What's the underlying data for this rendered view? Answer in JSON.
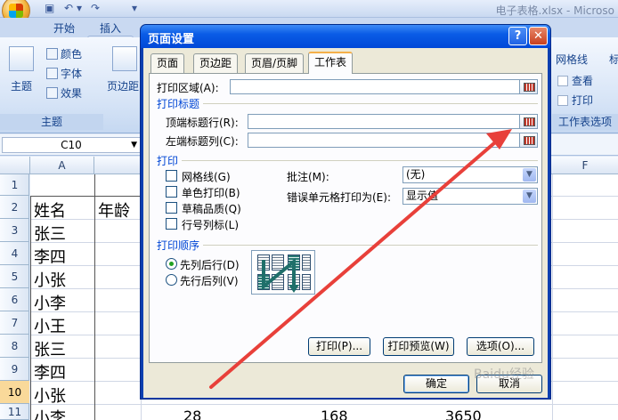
{
  "app": {
    "window_title": "电子表格.xlsx - Microso",
    "ribbon_tabs": [
      "开始",
      "插入"
    ],
    "ribbon": {
      "theme_group": "主题",
      "theme_btn": "主题",
      "colors": "颜色",
      "fonts": "字体",
      "effects": "效果",
      "margins": "页边距",
      "gridlines_head": "网格线",
      "view_label": "查看",
      "print_label": "打印",
      "sheet_options_group": "工作表选项",
      "headings_head": "标"
    },
    "name_box": "C10",
    "columns": [
      "A",
      "F"
    ],
    "rows": [
      "1",
      "2",
      "3",
      "4",
      "5",
      "6",
      "7",
      "8",
      "9",
      "10",
      "11"
    ],
    "active_row": "10",
    "cells": {
      "a2": "姓名",
      "b2": "年龄",
      "names": [
        "张三",
        "李四",
        "小张",
        "小李",
        "小王",
        "张三",
        "李四",
        "小张",
        "小李"
      ],
      "b11": "28",
      "c11": "168",
      "d11": "3650"
    }
  },
  "dialog": {
    "title": "页面设置",
    "help": "?",
    "close": "✕",
    "tabs": [
      "页面",
      "页边距",
      "页眉/页脚",
      "工作表"
    ],
    "active_tab": "工作表",
    "print_area_label": "打印区域(A):",
    "print_titles_section": "打印标题",
    "top_rows_label": "顶端标题行(R):",
    "left_cols_label": "左端标题列(C):",
    "print_section": "打印",
    "checkboxes": [
      "网格线(G)",
      "单色打印(B)",
      "草稿品质(Q)",
      "行号列标(L)"
    ],
    "comments_label": "批注(M):",
    "comments_value": "(无)",
    "errors_label": "错误单元格打印为(E):",
    "errors_value": "显示值",
    "order_section": "打印顺序",
    "order_options": [
      "先列后行(D)",
      "先行后列(V)"
    ],
    "order_selected": 0,
    "buttons": {
      "print": "打印(P)...",
      "preview": "打印预览(W)",
      "options": "选项(O)...",
      "ok": "确定",
      "cancel": "取消"
    }
  },
  "annotation": {
    "arrow_color": "#e8403a"
  },
  "watermark": "Baidu经验"
}
